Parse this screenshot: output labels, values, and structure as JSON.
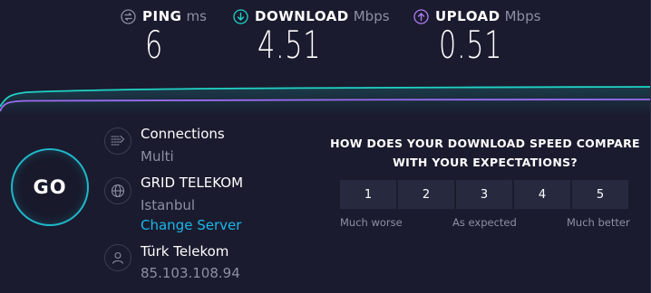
{
  "metrics": {
    "ping": {
      "label": "PING",
      "unit": "ms",
      "value": "6",
      "icon": "ping-icon",
      "color": "#8d8fa3"
    },
    "download": {
      "label": "DOWNLOAD",
      "unit": "Mbps",
      "value": "4.51",
      "icon": "download-arrow-icon",
      "color": "#1fd3c6"
    },
    "upload": {
      "label": "UPLOAD",
      "unit": "Mbps",
      "value": "0.51",
      "icon": "upload-arrow-icon",
      "color": "#b07cf2"
    }
  },
  "go_button": {
    "label": "GO",
    "color": "#1fb8c9"
  },
  "connections": {
    "title": "Connections",
    "value": "Multi",
    "icon": "connections-icon"
  },
  "server": {
    "title": "GRID TELEKOM",
    "location": "Istanbul",
    "change_label": "Change Server",
    "icon": "globe-icon"
  },
  "provider": {
    "title": "Türk Telekom",
    "ip": "85.103.108.94",
    "icon": "user-icon"
  },
  "survey": {
    "question_line1": "HOW DOES YOUR DOWNLOAD SPEED COMPARE",
    "question_line2": "WITH YOUR EXPECTATIONS?",
    "options": [
      "1",
      "2",
      "3",
      "4",
      "5"
    ],
    "label_low": "Much worse",
    "label_mid": "As expected",
    "label_high": "Much better"
  },
  "colors": {
    "background": "#1a1b2e",
    "download_line": "#1fd3c6",
    "upload_line": "#9b6cf0",
    "link": "#1ab7ea",
    "muted_text": "#8d8fa3"
  }
}
